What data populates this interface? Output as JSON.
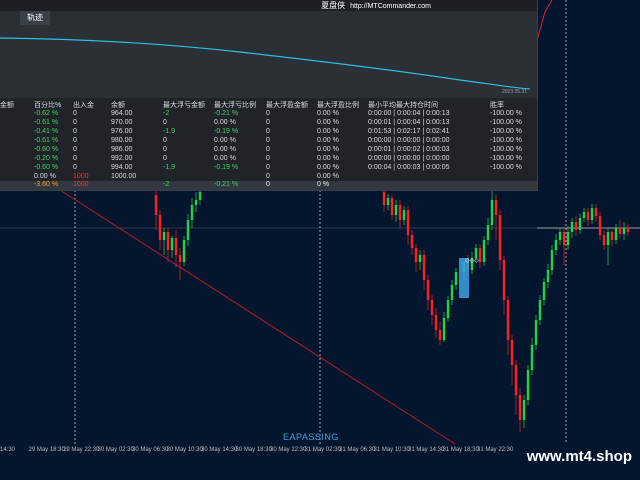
{
  "vendor": {
    "name_cn": "夏盘侠",
    "url": "http://MTCommander.com"
  },
  "panel": {
    "tab_label": "轨迹",
    "curve_date": "2023.05.31",
    "headers": [
      "金额",
      "百分比%",
      "出入金",
      "余额",
      "最大浮亏金额",
      "最大浮亏比例",
      "最大浮盈金额",
      "最大浮盈比例",
      "最小平均最大持仓时间",
      "胜率"
    ],
    "rows": [
      {
        "pct": "-0.62 %",
        "inout": "0",
        "balance": "964.00",
        "maxloss": "-2",
        "maxlosspct": "-0.21 %",
        "maxprofit": "0",
        "maxprofitpct": "0.00 %",
        "hold": "0:00:00 | 0:00:04 | 0:00:13",
        "win": "-100.00 %"
      },
      {
        "pct": "-0.61 %",
        "inout": "0",
        "balance": "970.00",
        "maxloss": "0",
        "maxlosspct": "0.00 %",
        "maxprofit": "0",
        "maxprofitpct": "0.00 %",
        "hold": "0:00:01 | 0:00:04 | 0:00:13",
        "win": "-100.00 %"
      },
      {
        "pct": "-0.41 %",
        "inout": "0",
        "balance": "976.00",
        "maxloss": "-1.9",
        "maxlosspct": "-0.19 %",
        "maxprofit": "0",
        "maxprofitpct": "0.00 %",
        "hold": "0:01:53 | 0:02:17 | 0:02:41",
        "win": "-100.00 %"
      },
      {
        "pct": "-0.61 %",
        "inout": "0",
        "balance": "980.00",
        "maxloss": "0",
        "maxlosspct": "0.00 %",
        "maxprofit": "0",
        "maxprofitpct": "0.00 %",
        "hold": "0:00:00 | 0:00:00 | 0:00:00",
        "win": "-100.00 %"
      },
      {
        "pct": "-0.60 %",
        "inout": "0",
        "balance": "986.00",
        "maxloss": "0",
        "maxlosspct": "0.00 %",
        "maxprofit": "0",
        "maxprofitpct": "0.00 %",
        "hold": "0:00:01 | 0:00:02 | 0:00:03",
        "win": "-100.00 %"
      },
      {
        "pct": "-0.20 %",
        "inout": "0",
        "balance": "992.00",
        "maxloss": "0",
        "maxlosspct": "0.00 %",
        "maxprofit": "0",
        "maxprofitpct": "0.00 %",
        "hold": "0:00:00 | 0:00:00 | 0:00:00",
        "win": "-100.00 %"
      },
      {
        "pct": "-0.60 %",
        "inout": "0",
        "balance": "994.00",
        "maxloss": "-1.9",
        "maxlosspct": "-0.19 %",
        "maxprofit": "0",
        "maxprofitpct": "0.00 %",
        "hold": "0:00:04 | 0:00:03 | 0:00:05",
        "win": "-100.00 %"
      },
      {
        "pct": "0.00 %",
        "inout": "1000",
        "balance": "1000.00",
        "maxloss": "",
        "maxlosspct": "",
        "maxprofit": "0",
        "maxprofitpct": "0.00 %",
        "hold": "",
        "win": ""
      }
    ],
    "total": {
      "pct": "-3.60 %",
      "inout": "1000",
      "maxloss": "-2",
      "maxlosspct": "-0.21 %",
      "maxprofit": "0",
      "maxprofitpct": "0 %"
    }
  },
  "time_axis": [
    "14:30",
    "29 May 18:30",
    "29 May 22:30",
    "30 May 02:30",
    "30 May 06:30",
    "30 May 10:30",
    "30 May 14:30",
    "30 May 18:30",
    "30 May 22:30",
    "31 May 02:30",
    "31 May 06:30",
    "31 May 10:30",
    "31 May 14:30",
    "31 May 18:30",
    "31 May 22:30"
  ],
  "ea_label": "EAPASSING",
  "brand": "www.mt4.shop",
  "colors": {
    "background": "#04152e",
    "bull": "#20d44a",
    "bear": "#ff2020",
    "curve": "#2bc0e0",
    "trendline": "#b0202a"
  }
}
